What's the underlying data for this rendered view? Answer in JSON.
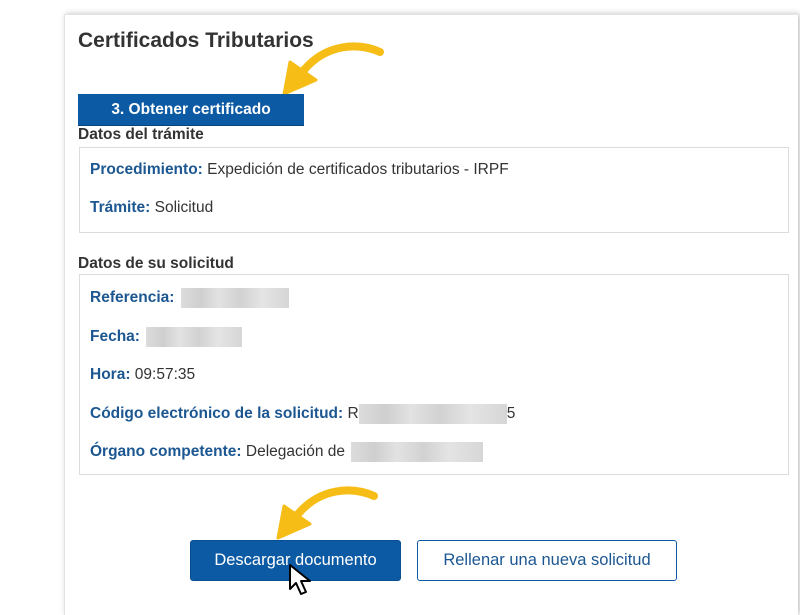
{
  "page": {
    "title": "Certificados Tributarios"
  },
  "step": {
    "label": "3. Obtener certificado"
  },
  "tramite_section": {
    "heading": "Datos del trámite",
    "fields": [
      {
        "label": "Procedimiento:",
        "value": "Expedición de certificados tributarios - IRPF"
      },
      {
        "label": "Trámite:",
        "value": "Solicitud"
      }
    ]
  },
  "solicitud_section": {
    "heading": "Datos de su solicitud",
    "fields": [
      {
        "label": "Referencia:",
        "value": ""
      },
      {
        "label": "Fecha:",
        "value": ""
      },
      {
        "label": "Hora:",
        "value": "09:57:35"
      },
      {
        "label": "Código electrónico de la solicitud:",
        "value_prefix": "R",
        "value_suffix": "5"
      },
      {
        "label": "Órgano competente:",
        "value": "Delegación de"
      }
    ]
  },
  "buttons": {
    "download": "Descargar documento",
    "new_request": "Rellenar una nueva solicitud"
  },
  "colors": {
    "primary": "#0c5aa4",
    "label_blue": "#1c5792",
    "arrow_yellow": "#f5bd16"
  },
  "icons": [
    "arrow-annotation-icon",
    "cursor-pointer-icon"
  ]
}
